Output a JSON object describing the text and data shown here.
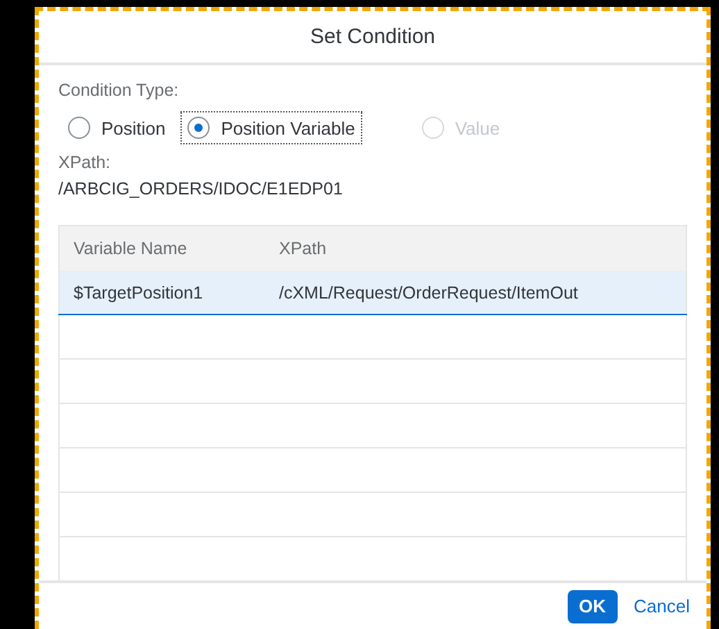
{
  "dialog": {
    "title": "Set Condition",
    "condition_type": {
      "label": "Condition Type:",
      "options": [
        {
          "label": "Position",
          "selected": false,
          "disabled": false
        },
        {
          "label": "Position Variable",
          "selected": true,
          "disabled": false
        },
        {
          "label": "Value",
          "selected": false,
          "disabled": true
        }
      ]
    },
    "xpath": {
      "label": "XPath:",
      "value": "/ARBCIG_ORDERS/IDOC/E1EDP01"
    },
    "table": {
      "columns": [
        "Variable Name",
        "XPath"
      ],
      "rows": [
        {
          "cells": [
            "$TargetPosition1",
            "/cXML/Request/OrderRequest/ItemOut"
          ],
          "selected": true
        }
      ]
    },
    "buttons": [
      {
        "label": "OK",
        "kind": "primary"
      },
      {
        "label": "Cancel",
        "kind": "link"
      }
    ]
  }
}
